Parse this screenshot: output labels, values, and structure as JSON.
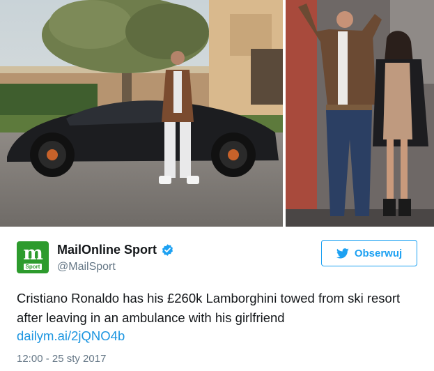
{
  "media": {
    "left_photo": "Man in a brown leather jacket standing in front of a matte black Lamborghini",
    "right_photo": "Man making a peace sign walking beside a woman in a beige dress"
  },
  "account": {
    "avatar_letter": "m",
    "avatar_caption": "Sport",
    "name": "MailOnline Sport",
    "handle": "@MailSport",
    "verified_icon": "verified-badge-icon",
    "brand_color": "#2d9b2d"
  },
  "follow_button": {
    "label": "Obserwuj",
    "icon": "twitter-bird-icon",
    "color": "#1da1f2"
  },
  "tweet": {
    "text": "Cristiano Ronaldo has his £260k Lamborghini towed from ski resort after leaving in an ambulance with his girlfriend",
    "link": "dailym.ai/2jQNO4b",
    "timestamp": "12:00 - 25 sty 2017",
    "link_color": "#1b95e0"
  }
}
